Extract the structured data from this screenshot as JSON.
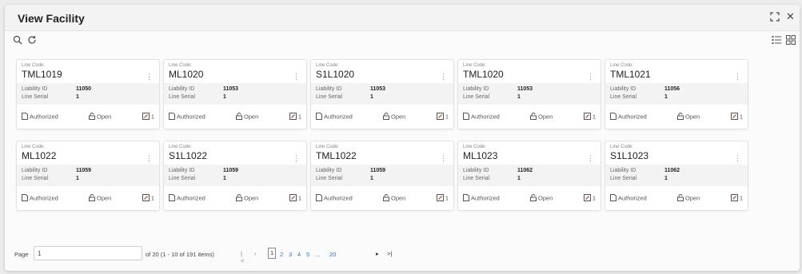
{
  "window": {
    "title": "View Facility"
  },
  "toolbar": {
    "search_icon": "search-icon",
    "refresh_icon": "refresh-icon",
    "list_view_icon": "list-view-icon",
    "grid_view_icon": "grid-view-icon"
  },
  "card_labels": {
    "line_code": "Line Code:",
    "liability_id": "Liability ID",
    "line_serial": "Line Serial",
    "authorized": "Authorized",
    "open": "Open"
  },
  "cards": [
    {
      "code": "TML1019",
      "liability_id": "11050",
      "line_serial": "1",
      "count": "1"
    },
    {
      "code": "ML1020",
      "liability_id": "11053",
      "line_serial": "1",
      "count": "1"
    },
    {
      "code": "S1L1020",
      "liability_id": "11053",
      "line_serial": "1",
      "count": "1"
    },
    {
      "code": "TML1020",
      "liability_id": "11053",
      "line_serial": "1",
      "count": "1"
    },
    {
      "code": "TML1021",
      "liability_id": "11056",
      "line_serial": "1",
      "count": "1"
    },
    {
      "code": "ML1022",
      "liability_id": "11059",
      "line_serial": "1",
      "count": "1"
    },
    {
      "code": "S1L1022",
      "liability_id": "11059",
      "line_serial": "1",
      "count": "1"
    },
    {
      "code": "TML1022",
      "liability_id": "11059",
      "line_serial": "1",
      "count": "1"
    },
    {
      "code": "ML1023",
      "liability_id": "11062",
      "line_serial": "1",
      "count": "1"
    },
    {
      "code": "S1L1023",
      "liability_id": "11062",
      "line_serial": "1",
      "count": "1"
    }
  ],
  "pagination": {
    "page_label": "Page",
    "page_value": "1",
    "of_text": "of 20  (1 - 10 of 191 items)",
    "pages": [
      "1",
      "2",
      "3",
      "4",
      "5",
      "...",
      "20"
    ],
    "current_page": "1"
  },
  "colors": {
    "accent": "#3a6fb6",
    "error_badge": "#c0392b"
  }
}
